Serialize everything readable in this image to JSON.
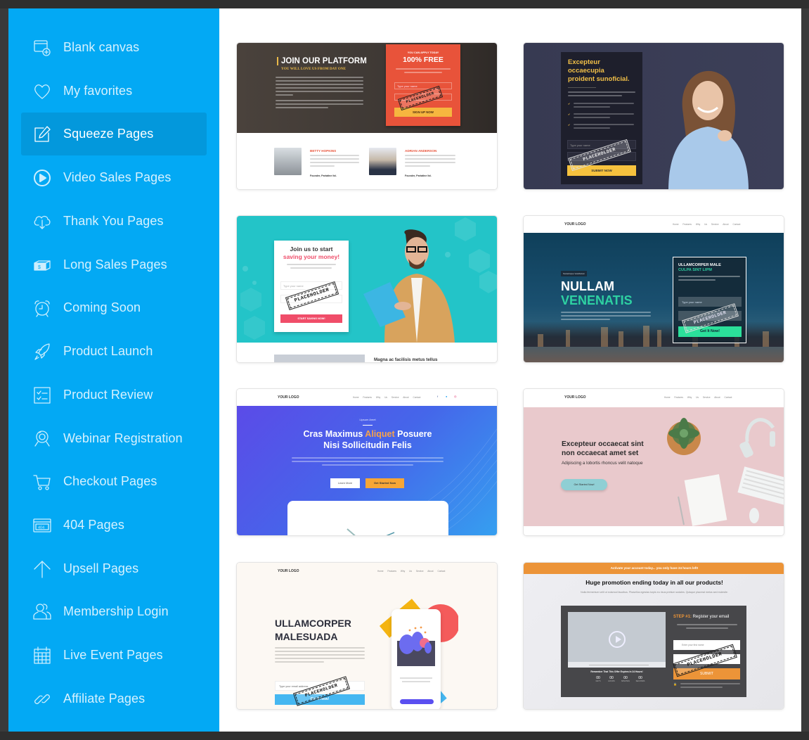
{
  "sidebar": {
    "accent": "#03a9f4",
    "active_bg": "#0398dc",
    "items": [
      {
        "label": "Blank canvas",
        "icon": "blank-canvas-icon",
        "active": false
      },
      {
        "label": "My favorites",
        "icon": "heart-icon",
        "active": false
      },
      {
        "label": "Squeeze Pages",
        "icon": "edit-icon",
        "active": true
      },
      {
        "label": "Video Sales Pages",
        "icon": "play-circle-icon",
        "active": false
      },
      {
        "label": "Thank You Pages",
        "icon": "cloud-download-icon",
        "active": false
      },
      {
        "label": "Long Sales Pages",
        "icon": "money-icon",
        "active": false
      },
      {
        "label": "Coming Soon",
        "icon": "alarm-clock-icon",
        "active": false
      },
      {
        "label": "Product Launch",
        "icon": "rocket-icon",
        "active": false
      },
      {
        "label": "Product Review",
        "icon": "checklist-icon",
        "active": false
      },
      {
        "label": "Webinar Registration",
        "icon": "webcam-icon",
        "active": false
      },
      {
        "label": "Checkout Pages",
        "icon": "cart-icon",
        "active": false
      },
      {
        "label": "404 Pages",
        "icon": "browser-404-icon",
        "active": false
      },
      {
        "label": "Upsell Pages",
        "icon": "arrow-up-icon",
        "active": false
      },
      {
        "label": "Membership Login",
        "icon": "users-icon",
        "active": false
      },
      {
        "label": "Live Event Pages",
        "icon": "calendar-icon",
        "active": false
      },
      {
        "label": "Affiliate Pages",
        "icon": "link-icon",
        "active": false
      }
    ]
  },
  "templates": {
    "stamp": "PLACEHOLDER",
    "t1": {
      "title": "JOIN OUR PLATFORM",
      "subtitle": "YOU WILL LOVE US FROM DAY ONE",
      "form_kicker": "YOU CAN APPLY TODAY",
      "form_big": "100% FREE",
      "input_placeholder": "Type your name",
      "button": "SIGN UP NOW",
      "person1_name": "BETTY HOPKINS",
      "person1_role": "Founder, Pariatine ltd.",
      "person2_name": "ADRIAN ANDERSON",
      "person2_role": "Founder, Pariatine ltd."
    },
    "t2": {
      "title_lines": [
        "Excepteur",
        "occaecupia",
        "proident sunoficial."
      ],
      "input_placeholder": "Type your name",
      "button": "SUBMIT NOW"
    },
    "t3": {
      "title1": "Join us to start",
      "title2": "saving your money!",
      "input_placeholder": "Type your name",
      "button": "START SAVING NOW!",
      "caption": "Magna ac facilisis metus tellus"
    },
    "t4": {
      "logo": "YOUR LOGO",
      "nav": "Home Features Why Us Service About Contact",
      "tag": "Scelerisque Vestibulum",
      "h1": "NULLAM",
      "h2": "VENENATIS",
      "form_h1": "ULLAMCORPER MALE",
      "form_h2": "CULPA SINT LIPM",
      "input_placeholder": "Type your name",
      "button": "Get It Now!"
    },
    "t5": {
      "logo": "YOUR LOGO",
      "nav": "Home Features Why Us Service About Contact",
      "kicker": "Lipsum Amet",
      "h_line1_a": "Cras Maximus ",
      "h_line1_accent": "Aliquet",
      "h_line1_b": " Posuere",
      "h_line2": "Nisi Sollicitudin Felis",
      "learn_more": "Learn More",
      "get_started": "Get Started Now"
    },
    "t6": {
      "logo": "YOUR LOGO",
      "nav": "Home Features Why Us Service About Contact",
      "h_line1": "Excepteur occaecat sint",
      "h_line2": "non occaecat amet set",
      "sub": "Adipiscing a lobortis rhoncus velit natoque",
      "button": "Get Started Now!"
    },
    "t7": {
      "logo": "YOUR LOGO",
      "nav": "Home Features Why Us Service About Contact",
      "h_line1": "ULLAMCORPER",
      "h_line2": "MALESUADA",
      "input_placeholder": "Type your email address",
      "button": "Get It Now!"
    },
    "t8": {
      "banner": "Activate your account today... you only have 24 hours left!",
      "title": "Huge promotion ending today in all our products!",
      "sub": "Nulla fermentum velit ut euismod faucibus. Phasellus egestas turpis eu risus pretium sodales. Quisque placerat metus sed molestie.",
      "step_label": "STEP #1:",
      "step_text": " Register your email",
      "input1_placeholder": "Enter your first name",
      "button": "SUBMIT",
      "remember": "Remember That This Offer Expires In 24 Hours!",
      "timer": [
        {
          "value": "00",
          "unit": "DAYS"
        },
        {
          "value": "00",
          "unit": "HOURS"
        },
        {
          "value": "00",
          "unit": "MINUTES"
        },
        {
          "value": "00",
          "unit": "SECONDS"
        }
      ]
    }
  }
}
